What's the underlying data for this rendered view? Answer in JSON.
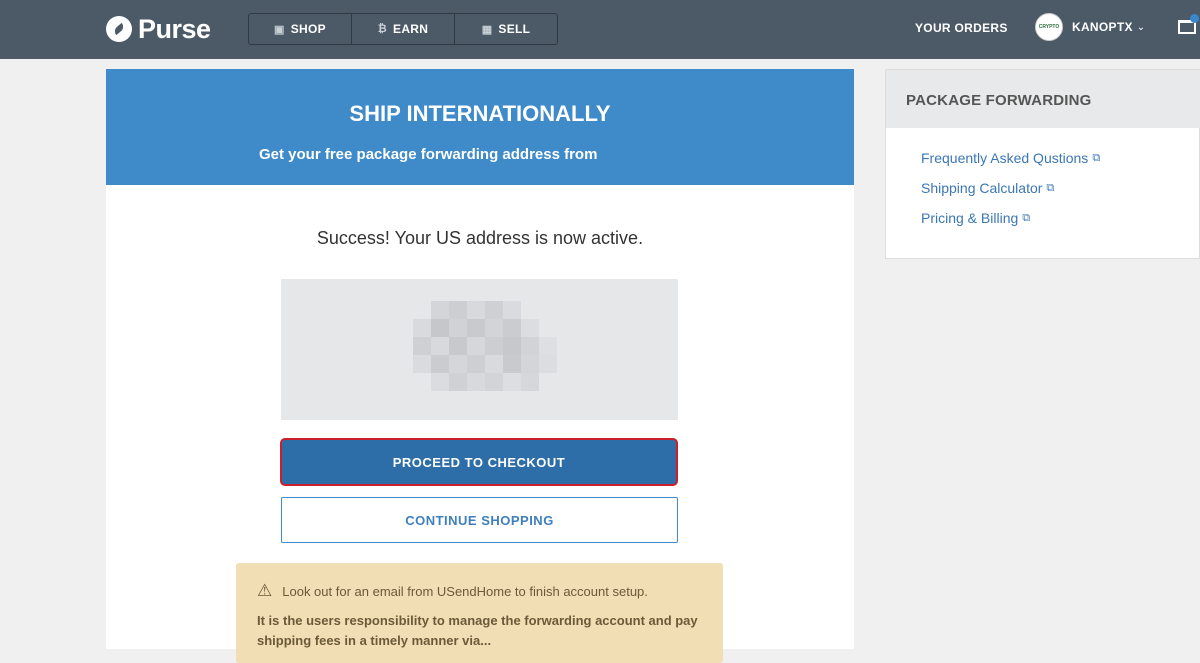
{
  "header": {
    "logo_text": "Purse",
    "nav": [
      {
        "label": "SHOP",
        "icon": "gift-icon"
      },
      {
        "label": "EARN",
        "icon": "bitcoin-icon"
      },
      {
        "label": "SELL",
        "icon": "calculator-icon"
      }
    ],
    "orders_label": "YOUR ORDERS",
    "username": "KANOPTX",
    "avatar_text": "CRYPTO"
  },
  "hero": {
    "title": "SHIP INTERNATIONALLY",
    "subtitle": "Get your free package forwarding address from"
  },
  "main": {
    "success_text": "Success! Your US address is now active.",
    "checkout_label": "PROCEED TO CHECKOUT",
    "continue_label": "CONTINUE SHOPPING"
  },
  "notice": {
    "line1": "Look out for an email from USendHome to finish account setup.",
    "line2": "It is the users responsibility to manage the forwarding account and pay shipping fees in a timely manner via..."
  },
  "sidebar": {
    "title": "PACKAGE FORWARDING",
    "links": [
      {
        "label": "Frequently Asked Qustions"
      },
      {
        "label": "Shipping Calculator"
      },
      {
        "label": "Pricing & Billing"
      }
    ]
  },
  "colors": {
    "header_bg": "#4b5a66",
    "hero_bg": "#3f8ac9",
    "checkout_bg": "#2d6ea8",
    "highlight_border": "#cc1f2c",
    "notice_bg": "#f2deb4"
  }
}
